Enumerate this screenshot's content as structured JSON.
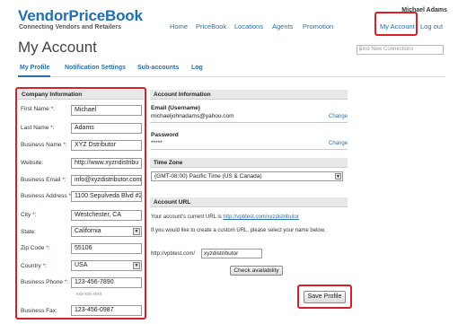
{
  "header": {
    "logo_title": "VendorPriceBook",
    "logo_subtitle": "Connecting Vendors and Retailers",
    "user_name": "Michael Adams",
    "nav": [
      "Home",
      "PriceBook",
      "Locations",
      "Agents",
      "Promotion",
      "My Account",
      "Log out"
    ]
  },
  "page": {
    "title": "My Account",
    "search_placeholder": "Find New Connections"
  },
  "subnav": [
    "My Profile",
    "Notification Settings",
    "Sub-accounts",
    "Log"
  ],
  "company": {
    "heading": "Company Information",
    "fields": [
      {
        "label": "First Name",
        "required": true,
        "value": "Michael"
      },
      {
        "label": "Last Name",
        "required": true,
        "value": "Adams"
      },
      {
        "label": "Business Name",
        "required": true,
        "value": "XYZ Dstributor"
      },
      {
        "label": "Website:",
        "required": false,
        "value": "http://www.xyzndistribu"
      },
      {
        "label": "Business Email",
        "required": true,
        "value": "info@xyzdistributor.com"
      },
      {
        "label": "Business Address",
        "required": true,
        "value": "1100 Sepulveda Blvd #2"
      },
      {
        "label": "City",
        "required": true,
        "value": "Westchester, CA"
      },
      {
        "label": "State:",
        "required": false,
        "value": "California"
      },
      {
        "label": "Zip Code",
        "required": true,
        "value": "55106"
      },
      {
        "label": "Country",
        "required": true,
        "value": "USA"
      },
      {
        "label": "Business Phone",
        "required": true,
        "value": "123-456-7890"
      },
      {
        "label": "Business Fax:",
        "required": false,
        "value": "123-456-0987"
      }
    ],
    "phone_hint": "xxx-xxx-xxxx",
    "required_mark": "*",
    "colon": ":"
  },
  "account": {
    "heading": "Account Information",
    "email_label": "Email (Username)",
    "email_value": "michaeljohnadams@yahoo.com",
    "password_label": "Password",
    "password_value": "*****",
    "change_label": "Change"
  },
  "timezone": {
    "heading": "Time Zone",
    "value": "(GMT-08:00) Pacific Time (US & Canada)"
  },
  "account_url": {
    "heading": "Account URL",
    "current_text": "Your account's current URL is",
    "current_url": "http://vpbtest.com/xyzdistributor",
    "custom_text": "If you would like to create a custom URL, please select your name below.",
    "prefix": "http://vpbtest.com/",
    "input_value": "xyzdistributor",
    "check_button": "Check availability"
  },
  "save_button": "Save Profile",
  "colors": {
    "brand_blue": "#1f6fb2",
    "link_blue": "#2a6fb0",
    "highlight_red": "#d9202a"
  },
  "icons": {
    "search": "magnifier-icon",
    "dropdown": "chevron-down-icon"
  }
}
